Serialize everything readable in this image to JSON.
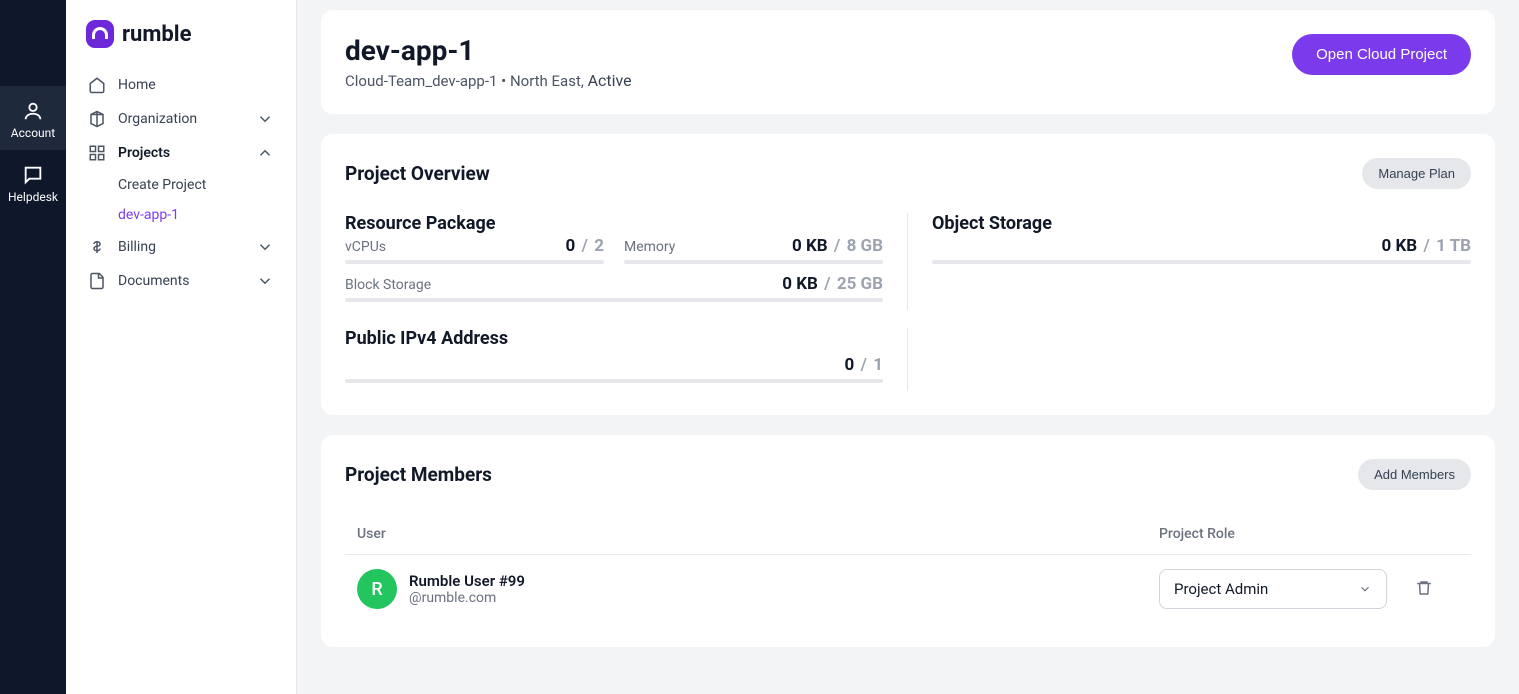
{
  "brand": "rumble",
  "rail": {
    "account": "Account",
    "helpdesk": "Helpdesk"
  },
  "sidebar": {
    "home": "Home",
    "organization": "Organization",
    "projects": "Projects",
    "create_project": "Create Project",
    "dev_app_1": "dev-app-1",
    "billing": "Billing",
    "documents": "Documents"
  },
  "header": {
    "title": "dev-app-1",
    "subtitle_org": "Cloud-Team_dev-app-1",
    "subtitle_region": "North East",
    "subtitle_status": "Active",
    "open_btn": "Open Cloud Project"
  },
  "overview": {
    "title": "Project Overview",
    "manage_plan": "Manage Plan",
    "resource_package": "Resource Package",
    "object_storage": "Object Storage",
    "public_ipv4": "Public IPv4 Address",
    "vcpus": {
      "label": "vCPUs",
      "value": "0",
      "max": "2"
    },
    "memory": {
      "label": "Memory",
      "value": "0 KB",
      "max": "8 GB"
    },
    "block_storage": {
      "label": "Block Storage",
      "value": "0 KB",
      "max": "25 GB"
    },
    "obj_storage": {
      "value": "0 KB",
      "max": "1 TB"
    },
    "ipv4": {
      "value": "0",
      "max": "1"
    }
  },
  "members": {
    "title": "Project Members",
    "add_btn": "Add Members",
    "col_user": "User",
    "col_role": "Project Role",
    "rows": [
      {
        "avatar_initial": "R",
        "name": "Rumble User #99",
        "email": "@rumble.com",
        "role": "Project Admin"
      }
    ]
  }
}
